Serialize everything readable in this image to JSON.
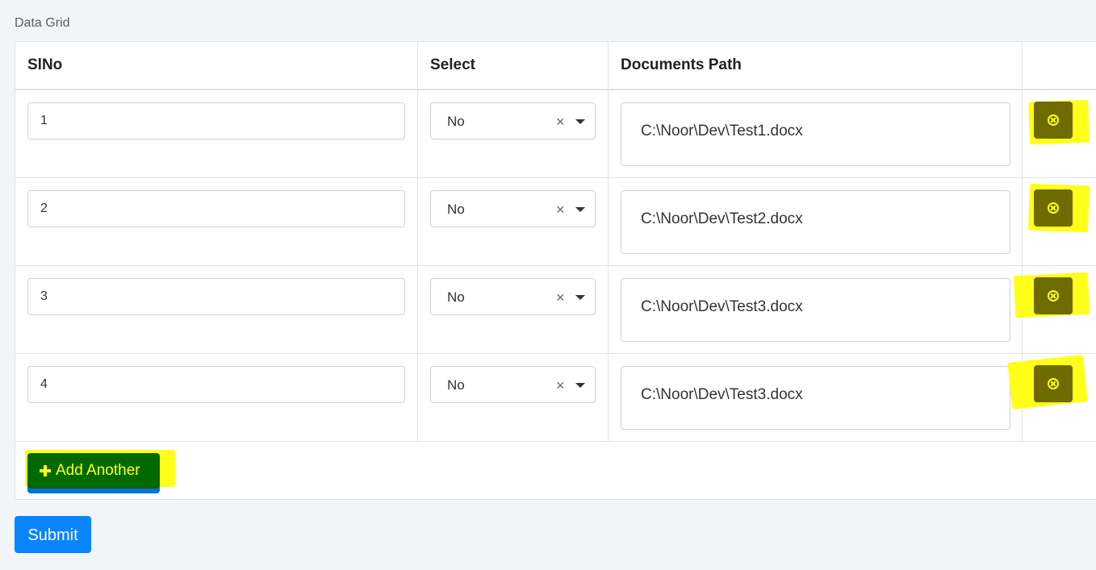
{
  "grid": {
    "label": "Data Grid",
    "columns": [
      "SlNo",
      "Select",
      "Documents Path",
      ""
    ],
    "rows": [
      {
        "slno": "1",
        "select": "No",
        "path": "C:\\Noor\\Dev\\Test1.docx"
      },
      {
        "slno": "2",
        "select": "No",
        "path": "C:\\Noor\\Dev\\Test2.docx"
      },
      {
        "slno": "3",
        "select": "No",
        "path": "C:\\Noor\\Dev\\Test3.docx"
      },
      {
        "slno": "4",
        "select": "No",
        "path": "C:\\Noor\\Dev\\Test3.docx"
      }
    ],
    "clear_glyph": "×",
    "delete_icon": "times-circle-icon",
    "add_another_label": "Add Another",
    "add_icon": "plus-icon"
  },
  "submit_label": "Submit",
  "colors": {
    "highlight": "#ffff1a",
    "primary": "#0a84ff",
    "add_button_bg": "#006a00"
  }
}
